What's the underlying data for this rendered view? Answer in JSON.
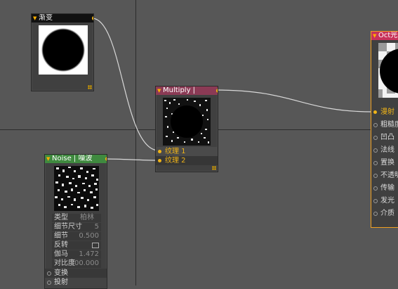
{
  "nodes": {
    "gradient": {
      "title": "渐变"
    },
    "multiply": {
      "title": "Multiply |",
      "inputs": [
        "纹理 1",
        "纹理 2"
      ]
    },
    "noise": {
      "title": "Noise | 噪波",
      "params": [
        {
          "label": "类型",
          "value": "柏林"
        },
        {
          "label": "细节尺寸",
          "value": "5"
        },
        {
          "label": "细节",
          "value": "0.500"
        },
        {
          "label": "反转",
          "value": ""
        },
        {
          "label": "伽马",
          "value": "1.472"
        },
        {
          "label": "对比度",
          "value": "100.000"
        }
      ],
      "ports": [
        "变换",
        "投射"
      ]
    },
    "material": {
      "title": "Oct光",
      "inputs": [
        "漫射",
        "粗糙度",
        "凹凸",
        "法线",
        "置换",
        "不透明",
        "传输",
        "发光",
        "介质"
      ]
    }
  },
  "colors": {
    "canvas": "#575757",
    "gradient_header": "#111111",
    "multiply_header": "#8b3a55",
    "noise_header": "#3f8a3f",
    "material_header": "#c8325a",
    "port": "#f0b418",
    "selection": "#f0a020"
  }
}
